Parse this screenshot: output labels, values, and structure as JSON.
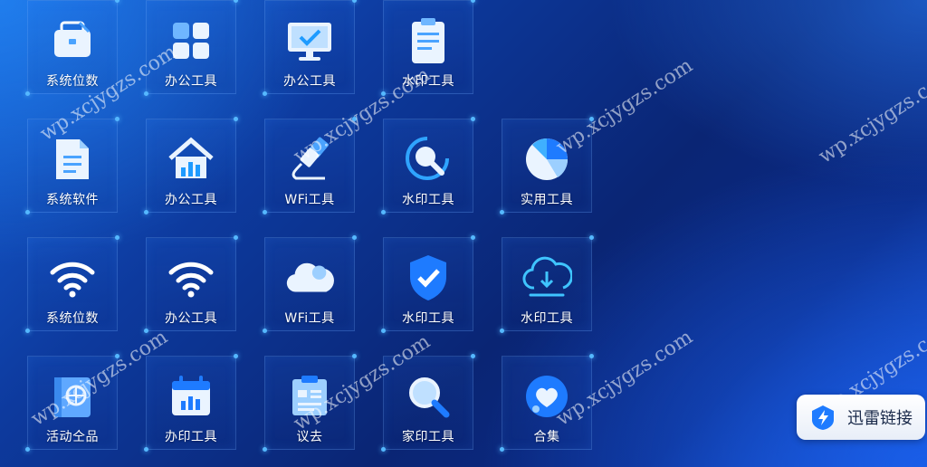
{
  "grid": {
    "row1": [
      {
        "label": "系统位数",
        "icon": "briefcase-icon"
      },
      {
        "label": "办公工具",
        "icon": "grid-apps-icon"
      },
      {
        "label": "办公工具",
        "icon": "monitor-check-icon"
      },
      {
        "label": "水印工具",
        "icon": "clipboard-icon"
      }
    ],
    "row2": [
      {
        "label": "系统软件",
        "icon": "document-icon"
      },
      {
        "label": "办公工具",
        "icon": "house-chart-icon"
      },
      {
        "label": "WFi工具",
        "icon": "usb-cable-icon"
      },
      {
        "label": "水印工具",
        "icon": "magnifier-ring-icon"
      },
      {
        "label": "实用工具",
        "icon": "pie-chart-icon"
      }
    ],
    "row3": [
      {
        "label": "系统位数",
        "icon": "wifi-icon"
      },
      {
        "label": "办公工具",
        "icon": "wifi-icon"
      },
      {
        "label": "WFi工具",
        "icon": "cloud-icon"
      },
      {
        "label": "水印工具",
        "icon": "shield-check-icon"
      },
      {
        "label": "水印工具",
        "icon": "cloud-download-icon"
      }
    ],
    "row4": [
      {
        "label": "活动仝品",
        "icon": "passport-icon"
      },
      {
        "label": "办印工具",
        "icon": "calendar-chart-icon"
      },
      {
        "label": "议去",
        "icon": "clipboard-list-icon"
      },
      {
        "label": "家印工具",
        "icon": "search-icon"
      },
      {
        "label": "合集",
        "icon": "heart-badge-icon"
      }
    ]
  },
  "watermark": "wp.xcjygzs.com",
  "xunlei_button": {
    "label": "迅雷链接",
    "icon": "xunlei-icon"
  },
  "colors": {
    "accent": "#55b8ff",
    "background": "#0a2574"
  }
}
